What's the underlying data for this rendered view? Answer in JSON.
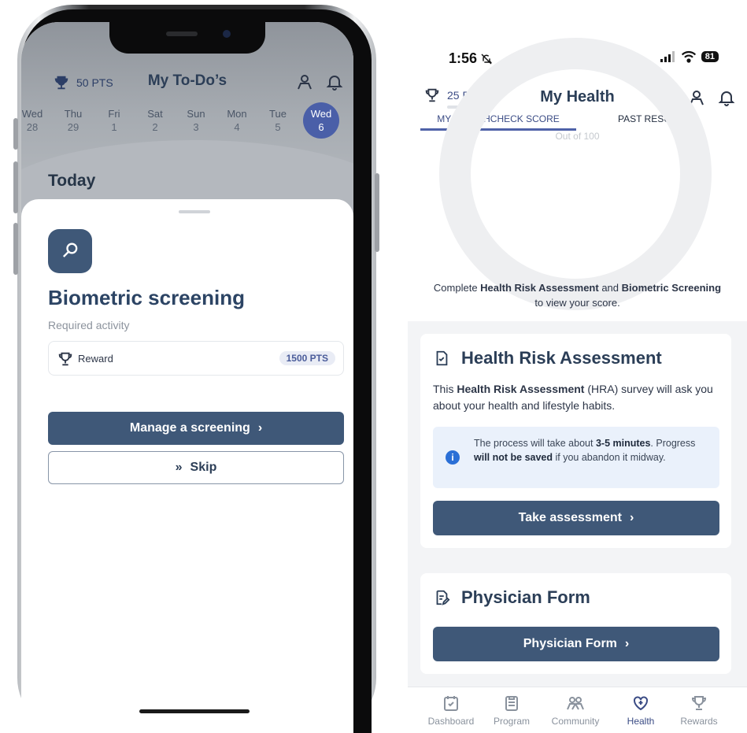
{
  "left_phone": {
    "header": {
      "points": "50 PTS",
      "title": "My To-Do’s"
    },
    "days": [
      {
        "name": "Wed",
        "num": "28"
      },
      {
        "name": "Thu",
        "num": "29"
      },
      {
        "name": "Fri",
        "num": "1"
      },
      {
        "name": "Sat",
        "num": "2"
      },
      {
        "name": "Sun",
        "num": "3"
      },
      {
        "name": "Mon",
        "num": "4"
      },
      {
        "name": "Tue",
        "num": "5"
      },
      {
        "name": "Wed",
        "num": "6"
      }
    ],
    "today_label": "Today",
    "sheet": {
      "title": "Biometric screening",
      "subtitle": "Required activity",
      "reward_label": "Reward",
      "reward_points": "1500 PTS",
      "primary_button": "Manage a screening",
      "primary_chevron": "›",
      "skip_button": "Skip",
      "skip_glyph": "»"
    }
  },
  "right_app": {
    "status_bar": {
      "time": "1:56",
      "battery": "81"
    },
    "header": {
      "points": "25 PTS",
      "title": "My Health"
    },
    "tabs": {
      "active": "MY HEALTHCHECK SCORE",
      "other": "PAST RESULTS"
    },
    "score": {
      "ring_text": "Out of 100",
      "note_prefix": "Complete ",
      "note_hra": "Health Risk Assessment",
      "note_mid": " and ",
      "note_bio": "Biometric Screening",
      "note_suffix": " to view your score."
    },
    "hra_card": {
      "title": "Health Risk Assessment",
      "desc_prefix": "This ",
      "desc_bold": "Health Risk Assessment",
      "desc_suffix": " (HRA) survey will ask you about your health and lifestyle habits.",
      "info_prefix": "The process will take about ",
      "info_bold1": "3-5 minutes",
      "info_mid": ". Progress ",
      "info_bold2": "will not be saved",
      "info_suffix": " if you abandon it midway.",
      "info_icon": "i",
      "button": "Take assessment",
      "button_chevron": "›"
    },
    "physician_card": {
      "title": "Physician Form",
      "button": "Physician Form",
      "button_chevron": "›"
    },
    "tabbar": [
      {
        "label": "Dashboard",
        "icon": "calendar-check-icon"
      },
      {
        "label": "Program",
        "icon": "clipboard-icon"
      },
      {
        "label": "Community",
        "icon": "people-icon"
      },
      {
        "label": "Health",
        "icon": "heart-plus-icon"
      },
      {
        "label": "Rewards",
        "icon": "trophy-icon"
      }
    ],
    "colors": {
      "primary": "#3f5878",
      "accent": "#4f62a8",
      "info_bg": "#eaf1fb",
      "info_icon": "#2a6fd6"
    }
  }
}
